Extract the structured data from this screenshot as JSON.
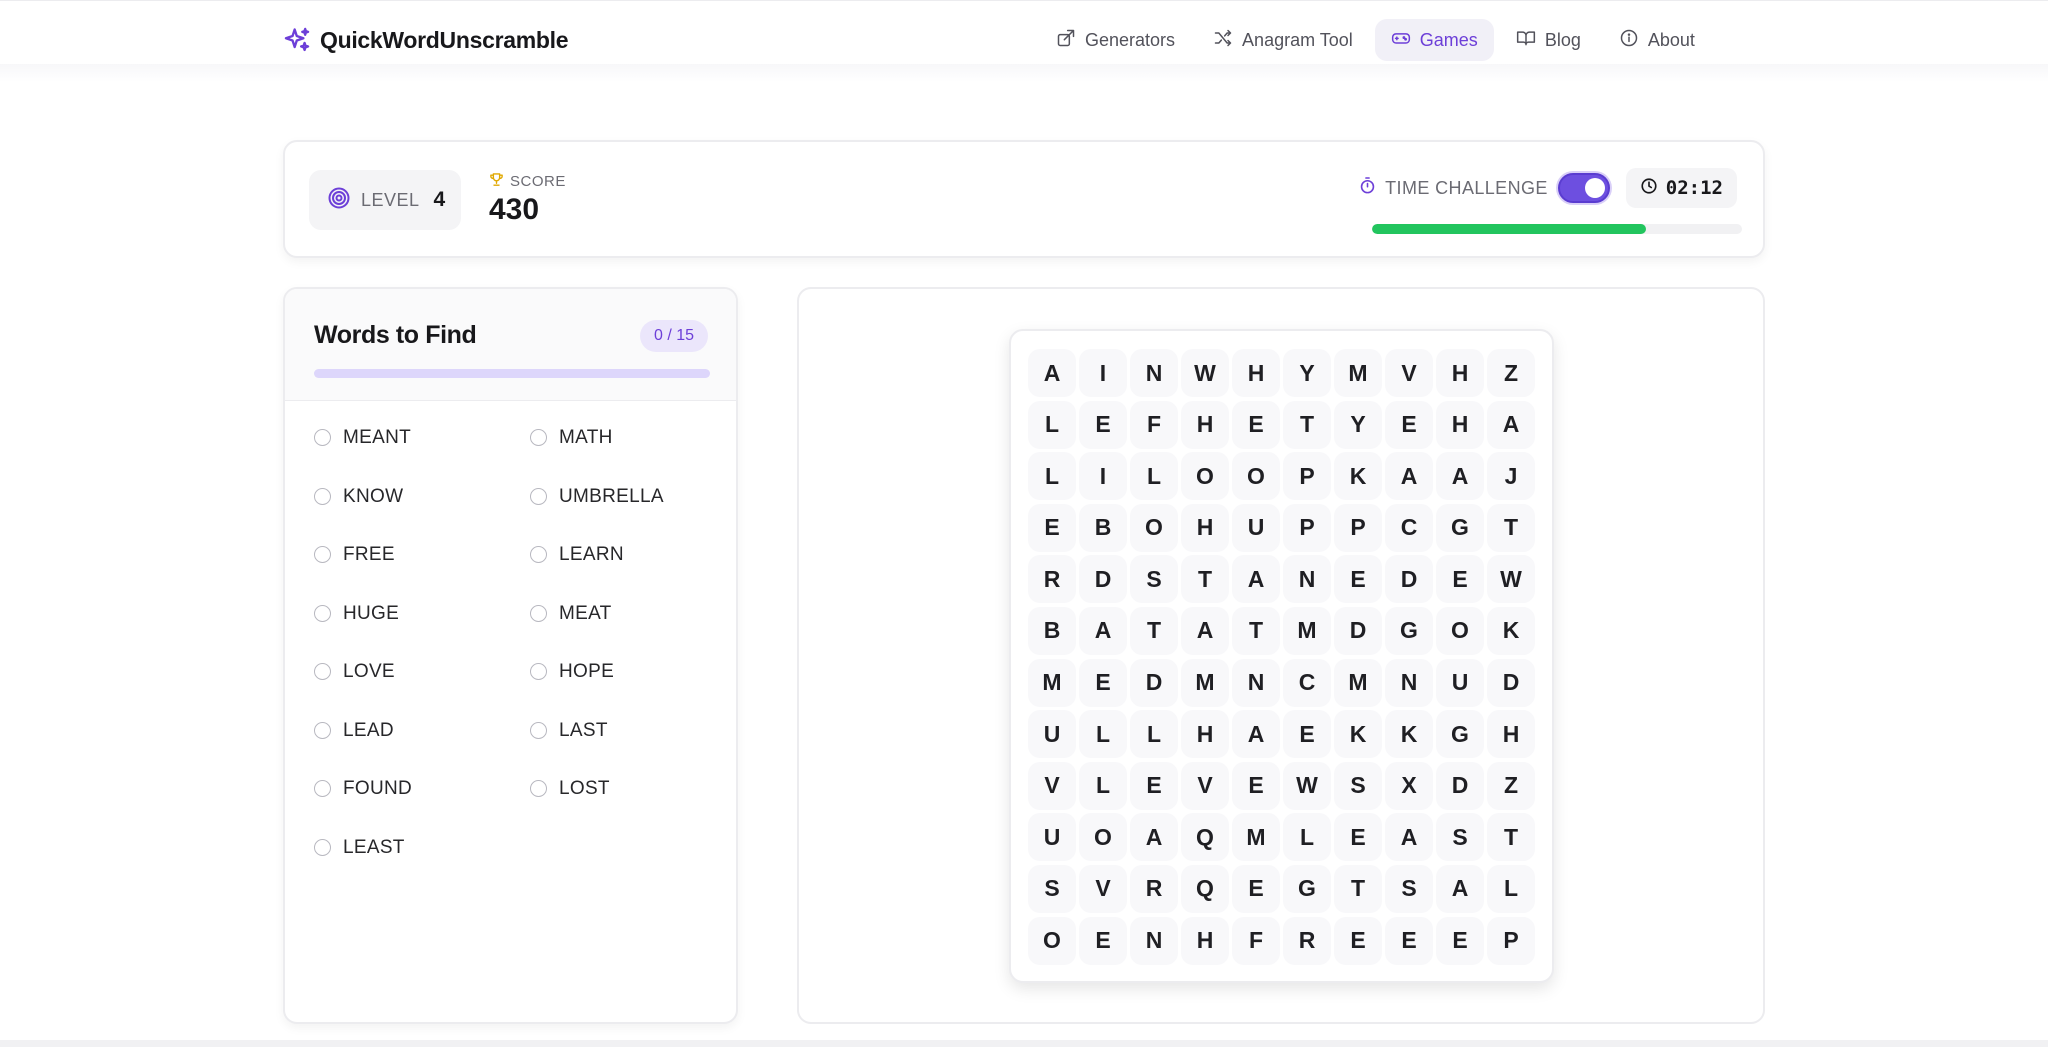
{
  "header": {
    "logo_text": "QuickWordUnscramble",
    "nav": [
      {
        "label": "Generators",
        "icon": "share-box-icon",
        "active": false
      },
      {
        "label": "Anagram Tool",
        "icon": "shuffle-icon",
        "active": false
      },
      {
        "label": "Games",
        "icon": "gamepad-icon",
        "active": true
      },
      {
        "label": "Blog",
        "icon": "book-open-icon",
        "active": false
      },
      {
        "label": "About",
        "icon": "info-circle-icon",
        "active": false
      }
    ]
  },
  "status": {
    "level_label": "LEVEL",
    "level_value": "4",
    "score_label": "SCORE",
    "score_value": "430",
    "time_challenge_label": "TIME CHALLENGE",
    "time_challenge_on": true,
    "timer": "02:12",
    "time_remaining_fraction": 0.74
  },
  "words_panel": {
    "title": "Words to Find",
    "found_badge": "0 / 15",
    "words": [
      "MEANT",
      "MATH",
      "KNOW",
      "UMBRELLA",
      "FREE",
      "LEARN",
      "HUGE",
      "MEAT",
      "LOVE",
      "HOPE",
      "LEAD",
      "LAST",
      "FOUND",
      "LOST",
      "LEAST"
    ]
  },
  "grid": {
    "rows": [
      [
        "A",
        "I",
        "N",
        "W",
        "H",
        "Y",
        "M",
        "V",
        "H",
        "Z"
      ],
      [
        "L",
        "E",
        "F",
        "H",
        "E",
        "T",
        "Y",
        "E",
        "H",
        "A"
      ],
      [
        "L",
        "I",
        "L",
        "O",
        "O",
        "P",
        "K",
        "A",
        "A",
        "J"
      ],
      [
        "E",
        "B",
        "O",
        "H",
        "U",
        "P",
        "P",
        "C",
        "G",
        "T"
      ],
      [
        "R",
        "D",
        "S",
        "T",
        "A",
        "N",
        "E",
        "D",
        "E",
        "W"
      ],
      [
        "B",
        "A",
        "T",
        "A",
        "T",
        "M",
        "D",
        "G",
        "O",
        "K"
      ],
      [
        "M",
        "E",
        "D",
        "M",
        "N",
        "C",
        "M",
        "N",
        "U",
        "D"
      ],
      [
        "U",
        "L",
        "L",
        "H",
        "A",
        "E",
        "K",
        "K",
        "G",
        "H"
      ],
      [
        "V",
        "L",
        "E",
        "V",
        "E",
        "W",
        "S",
        "X",
        "D",
        "Z"
      ],
      [
        "U",
        "O",
        "A",
        "Q",
        "M",
        "L",
        "E",
        "A",
        "S",
        "T"
      ],
      [
        "S",
        "V",
        "R",
        "Q",
        "E",
        "G",
        "T",
        "S",
        "A",
        "L"
      ],
      [
        "O",
        "E",
        "N",
        "H",
        "F",
        "R",
        "E",
        "E",
        "E",
        "P"
      ]
    ]
  },
  "colors": {
    "accent": "#6d3fd8",
    "progress": "#22c55e",
    "badge_bg": "#ebe6fb"
  }
}
